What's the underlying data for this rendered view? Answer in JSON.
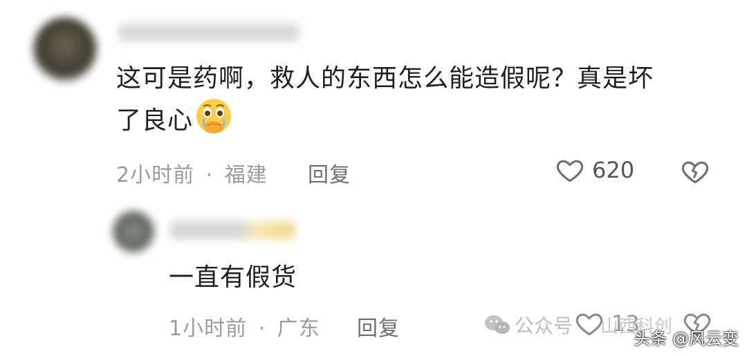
{
  "comments": [
    {
      "text_line1": "这可是药啊，救人的东西怎么能造假呢？真是坏",
      "text_line2": "了良心",
      "time": "2小时前",
      "separator": "·",
      "location": "福建",
      "reply_label": "回复",
      "likes": "620",
      "emoji_icon": "pleading-face-crying-icon"
    }
  ],
  "replies": [
    {
      "text": "一直有假货",
      "time": "1小时前",
      "separator": "·",
      "location": "广东",
      "reply_label": "回复",
      "likes": "13"
    }
  ],
  "watermarks": {
    "wechat_label": "公众号",
    "wechat_account": "山西科创",
    "toutiao": "头条 @风云变"
  },
  "colors": {
    "text": "#1f1f1f",
    "meta": "#9b9b9b",
    "icon": "#6e6e6e"
  }
}
